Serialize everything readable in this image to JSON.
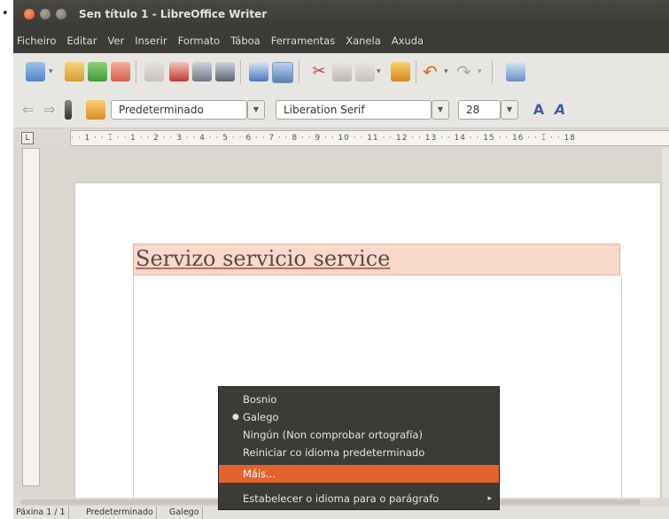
{
  "window": {
    "title": "Sen título 1 - LibreOffice Writer"
  },
  "menubar": {
    "items": [
      "Ficheiro",
      "Editar",
      "Ver",
      "Inserir",
      "Formato",
      "Táboa",
      "Ferramentas",
      "Xanela",
      "Axuda"
    ]
  },
  "toolbar2": {
    "paragraph_style": "Predeterminado",
    "font_name": "Liberation Serif",
    "font_size": "28"
  },
  "ruler": {
    "ticks": "· · 1 · · ⌶ · · 1 · · 2 · · 3 · · 4 · · 5 · · 6 · · 7 · · 8 · · 9 · · 10 · · 11 · · 12 · · 13 · · 14 · · 15 · · 16 · · ⌶ · · 18"
  },
  "document": {
    "text": "Servizo servicio service"
  },
  "statusbar": {
    "page": "Páxina 1 / 1",
    "style": "Predeterminado",
    "language": "Galego"
  },
  "context_menu": {
    "items": [
      {
        "label": "Bosnio",
        "selected": false,
        "highlighted": false,
        "submenu": false
      },
      {
        "label": "Galego",
        "selected": true,
        "highlighted": false,
        "submenu": false
      },
      {
        "label": "Ningún (Non comprobar ortografía)",
        "selected": false,
        "highlighted": false,
        "submenu": false
      },
      {
        "label": "Reiniciar co idioma predeterminado",
        "selected": false,
        "highlighted": false,
        "submenu": false
      },
      {
        "label": "Máis...",
        "selected": false,
        "highlighted": true,
        "submenu": false
      },
      {
        "label": "Estabelecer o idioma para o parágrafo",
        "selected": false,
        "highlighted": false,
        "submenu": true
      }
    ]
  },
  "colors": {
    "menu_bg": "#3c3b37",
    "highlight": "#e5622e",
    "text_highlight_bg": "#f8d9cc"
  }
}
